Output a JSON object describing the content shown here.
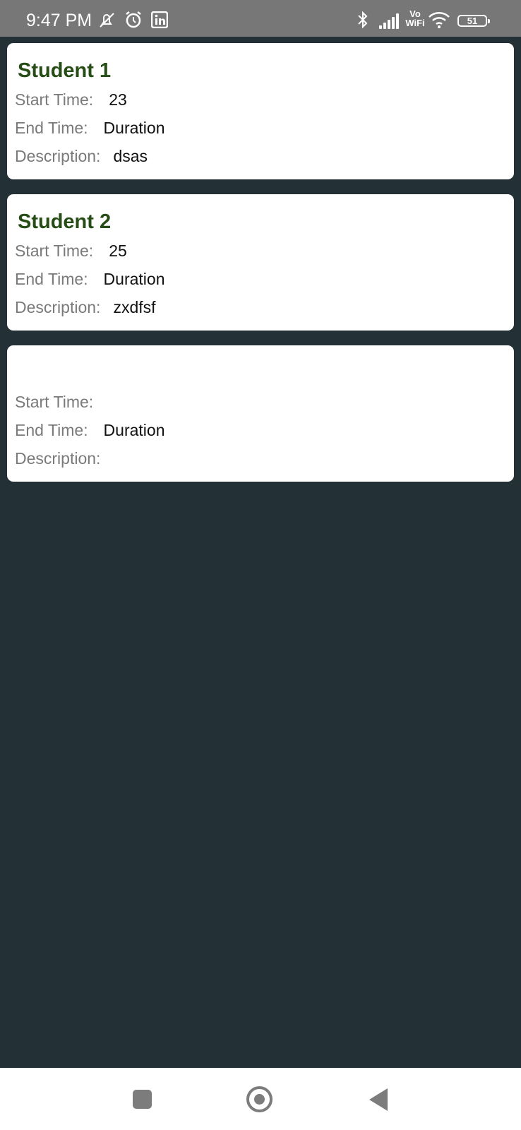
{
  "status_bar": {
    "time": "9:47 PM",
    "vo_label": "Vo",
    "wifi_label": "WiFi",
    "battery_level": "51",
    "icons": [
      "mute-icon",
      "alarm-icon",
      "linkedin-icon",
      "bluetooth-icon",
      "signal-icon",
      "vowifi-icon",
      "wifi-icon",
      "battery-icon"
    ]
  },
  "labels": {
    "start_time": "Start Time:",
    "end_time": "End Time:",
    "description": "Description:"
  },
  "records": [
    {
      "title": "Student 1",
      "start_time": "23",
      "end_time": "Duration",
      "description": "dsas"
    },
    {
      "title": "Student 2",
      "start_time": "25",
      "end_time": "Duration",
      "description": "zxdfsf"
    },
    {
      "title": "",
      "start_time": "",
      "end_time": "Duration",
      "description": ""
    }
  ],
  "nav_bar": {
    "icons": [
      "recents-square-icon",
      "home-circle-icon",
      "back-triangle-icon"
    ]
  },
  "colors": {
    "background": "#233036",
    "title_green": "#254d15",
    "status_bar": "#777777",
    "label_gray": "#7a7a7a"
  }
}
